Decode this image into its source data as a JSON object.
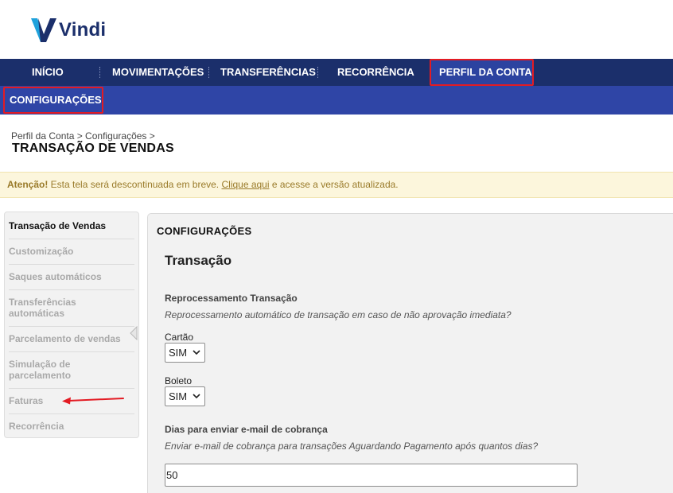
{
  "brand": {
    "name": "Vindi"
  },
  "topnav": {
    "items": [
      "INÍCIO",
      "MOVIMENTAÇÕES",
      "TRANSFERÊNCIAS",
      "RECORRÊNCIA",
      "PERFIL DA CONTA"
    ],
    "active": "PERFIL DA CONTA"
  },
  "subnav": {
    "items": [
      "CONFIGURAÇÕES"
    ]
  },
  "breadcrumb": "Perfil da Conta > Configurações >",
  "page_title": "TRANSAÇÃO DE VENDAS",
  "alert": {
    "strong": "Atenção!",
    "text_before": " Esta tela será descontinuada em breve. ",
    "link": "Clique aqui",
    "text_after": " e acesse a versão atualizada."
  },
  "sidebar": {
    "items": [
      {
        "label": "Transação de Vendas",
        "active": true
      },
      {
        "label": "Customização",
        "active": false
      },
      {
        "label": "Saques automáticos",
        "active": false
      },
      {
        "label": "Transferências automáticas",
        "active": false
      },
      {
        "label": "Parcelamento de vendas",
        "active": false
      },
      {
        "label": "Simulação de parcelamento",
        "active": false
      },
      {
        "label": "Faturas",
        "active": false
      },
      {
        "label": "Recorrência",
        "active": false
      }
    ]
  },
  "panel": {
    "header": "CONFIGURAÇÕES",
    "section_title": "Transação",
    "reprocess": {
      "label": "Reprocessamento Transação",
      "description": "Reprocessamento automático de transação em caso de não aprovação imediata?",
      "cartao_label": "Cartão",
      "cartao_value": "SIM",
      "boleto_label": "Boleto",
      "boleto_value": "SIM"
    },
    "email": {
      "label": "Dias para enviar e-mail de cobrança",
      "description": "Enviar e-mail de cobrança para transações Aguardando Pagamento após quantos dias?",
      "value": "50"
    }
  },
  "colors": {
    "nav_dark": "#1b2f6b",
    "nav_sub": "#2f45a6",
    "highlight_red": "#e31b23",
    "alert_bg": "#fcf6dc"
  }
}
